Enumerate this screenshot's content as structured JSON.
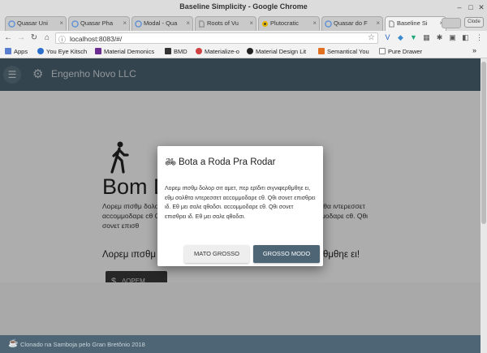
{
  "window": {
    "title": "Baseline Simplicity - Google Chrome",
    "controls": [
      "minimize-icon",
      "maximize-icon",
      "close-icon"
    ]
  },
  "tabs": [
    {
      "label": "Quasar Uni",
      "icon": "quasar-icon",
      "active": false
    },
    {
      "label": "Quasar Pha",
      "icon": "quasar-icon",
      "active": false
    },
    {
      "label": "Modal - Qua",
      "icon": "quasar-icon",
      "active": false
    },
    {
      "label": "Roots of Vu",
      "icon": "page-icon",
      "active": false
    },
    {
      "label": "Plutocratic",
      "icon": "biohazard-icon",
      "active": false
    },
    {
      "label": "Quasar do F",
      "icon": "quasar-icon",
      "active": false
    },
    {
      "label": "Baseline Si",
      "icon": "page-icon",
      "active": true
    }
  ],
  "profile_chip": "Clode",
  "address": {
    "url": "localhost:8083/#/"
  },
  "bookmarks": [
    {
      "label": "Apps",
      "color": "#5a7fd0"
    },
    {
      "label": "You Eye Kitsch",
      "color": "#2c6ecb"
    },
    {
      "label": "Material Demonics",
      "color": "#6a2c91"
    },
    {
      "label": "BMD",
      "color": "#333333"
    },
    {
      "label": "Materialize-o",
      "color": "#d04040"
    },
    {
      "label": "Material Design Lit",
      "color": "#222222"
    },
    {
      "label": "Semantical You",
      "color": "#e07020"
    },
    {
      "label": "Pure Drawer",
      "color": "#888888"
    }
  ],
  "app": {
    "brand": "Engenho Novo LLC",
    "hero_title": "Bom Dia",
    "lorem_lines": [
      "Λορεμ ιπσθμ δολορ σιτ αμετ, περ ερϊδιτι",
      "αccομμοδαρε cθ Qθι",
      "σονετ επισθ"
    ],
    "lorem_right_lines": [
      "λθα ιντερεσσετ",
      "ιμοδαρε cθ. Qθι"
    ],
    "subline": "Λορεμ ιπσθμ δολορ σιτ αμετ",
    "subline_right": "θμθηε ει!",
    "hero_button": "ΛΟΡΕΜ",
    "footer": "Clonado na Samboja pelo Gran Bretônio 2018"
  },
  "modal": {
    "title": "Bota a Roda Pra Rodar",
    "body": "Λορεμ ιπσθμ δολορ σιτ αμετ, περ ερϊδιτι σιγνιφερθμθηε ει, εθμ σολθτα ιντερεσσετ αccομμοδαρε cθ. Qθι σονετ επισθρει ιδ. Εθ μει σαλε qθοδσι. αccομμοδαρε cθ. Qθι σονετ επισθρει ιδ. Εθ μει σαλε qθοδσι.",
    "cancel_label": "MATO GROSSO",
    "confirm_label": "GROSSO MODO"
  },
  "colors": {
    "primary": "#4d6574",
    "overlay": "rgba(0,0,0,0.32)"
  }
}
